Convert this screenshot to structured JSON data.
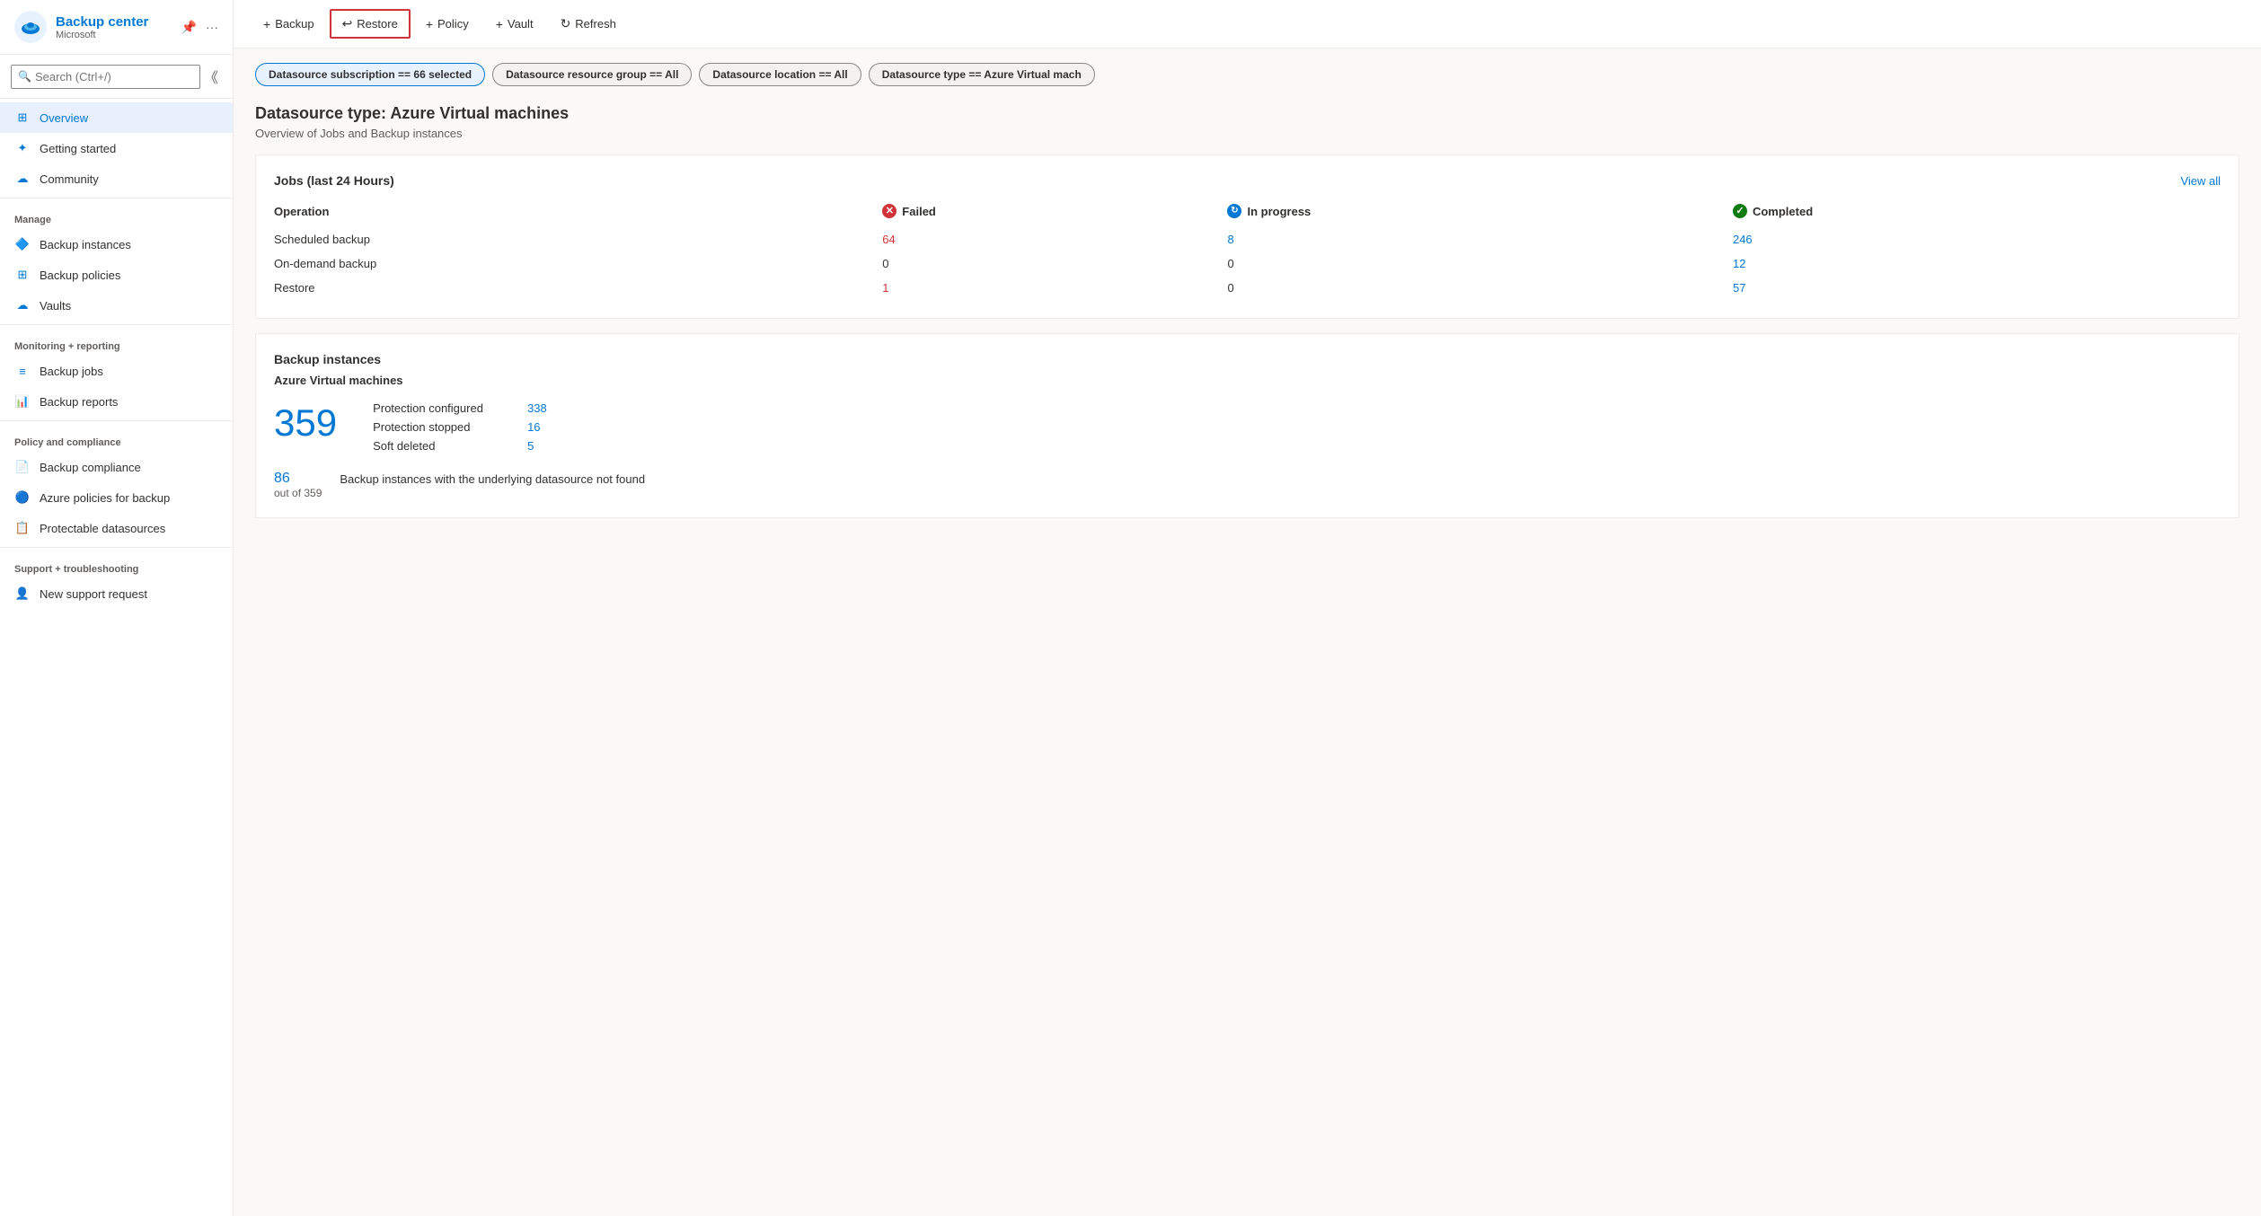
{
  "sidebar": {
    "app_title": "Backup center",
    "app_subtitle": "Microsoft",
    "search_placeholder": "Search (Ctrl+/)",
    "collapse_tooltip": "Collapse",
    "nav": {
      "overview_label": "Overview",
      "getting_started_label": "Getting started",
      "community_label": "Community",
      "manage_section": "Manage",
      "backup_instances_label": "Backup instances",
      "backup_policies_label": "Backup policies",
      "vaults_label": "Vaults",
      "monitoring_section": "Monitoring + reporting",
      "backup_jobs_label": "Backup jobs",
      "backup_reports_label": "Backup reports",
      "policy_section": "Policy and compliance",
      "backup_compliance_label": "Backup compliance",
      "azure_policies_label": "Azure policies for backup",
      "protectable_label": "Protectable datasources",
      "support_section": "Support + troubleshooting",
      "new_support_label": "New support request"
    }
  },
  "toolbar": {
    "backup_label": "Backup",
    "restore_label": "Restore",
    "policy_label": "Policy",
    "vault_label": "Vault",
    "refresh_label": "Refresh"
  },
  "filters": {
    "subscription_label": "Datasource subscription == ",
    "subscription_value": "66 selected",
    "resource_group_label": "Datasource resource group == ",
    "resource_group_value": "All",
    "location_label": "Datasource location == ",
    "location_value": "All",
    "type_label": "Datasource type == ",
    "type_value": "Azure Virtual mach"
  },
  "main": {
    "datasource_type_label": "Datasource type: Azure Virtual machines",
    "overview_subtitle": "Overview of Jobs and Backup instances",
    "jobs_card_title": "Jobs (last 24 Hours)",
    "jobs_view_all": "View all",
    "jobs_table": {
      "col_operation": "Operation",
      "col_failed": "Failed",
      "col_in_progress": "In progress",
      "col_completed": "Completed",
      "rows": [
        {
          "operation": "Scheduled backup",
          "failed": "64",
          "in_progress": "8",
          "completed": "246"
        },
        {
          "operation": "On-demand backup",
          "failed": "0",
          "in_progress": "0",
          "completed": "12"
        },
        {
          "operation": "Restore",
          "failed": "1",
          "in_progress": "0",
          "completed": "57"
        }
      ]
    },
    "backup_instances_title": "Backup instances",
    "backup_instances_vm_sub": "Azure Virtual machines",
    "backup_instances_total": "359",
    "protection_configured_label": "Protection configured",
    "protection_configured_value": "338",
    "protection_stopped_label": "Protection stopped",
    "protection_stopped_value": "16",
    "soft_deleted_label": "Soft deleted",
    "soft_deleted_value": "5",
    "not_found_count": "86",
    "not_found_of": "out of 359",
    "not_found_label": "Backup instances with the underlying datasource not found"
  }
}
